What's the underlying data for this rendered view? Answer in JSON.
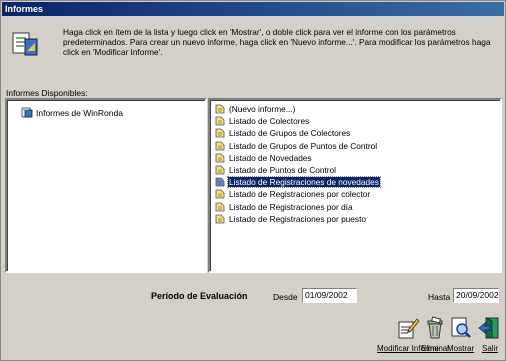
{
  "window": {
    "title": "Informes"
  },
  "info": {
    "icon": "report-info-icon",
    "text": "Haga click en ítem de la lista y luego click en 'Mostrar', o doble click para ver el informe con los parámetros predeterminados. Para crear un nuevo informe, haga click en 'Nuevo informe...'. Para modificar los parámetros haga click en 'Modificar Informe'."
  },
  "available_label": "Informes Disponibles:",
  "tree": {
    "items": [
      {
        "label": "Informes de WinRonda",
        "icon": "report-folder-icon"
      }
    ]
  },
  "reports": {
    "items": [
      {
        "label": "(Nuevo informe...)",
        "icon": "new-document-icon",
        "selected": false
      },
      {
        "label": "Listado de Colectores",
        "icon": "document-icon",
        "selected": false
      },
      {
        "label": "Listado de Grupos de Colectores",
        "icon": "document-icon",
        "selected": false
      },
      {
        "label": "Listado de Grupos de Puntos de Control",
        "icon": "document-icon",
        "selected": false
      },
      {
        "label": "Listado de Novedades",
        "icon": "document-icon",
        "selected": false
      },
      {
        "label": "Listado de Puntos de Control",
        "icon": "document-icon",
        "selected": false
      },
      {
        "label": "Listado de Registraciones de novedades",
        "icon": "document-icon",
        "selected": true
      },
      {
        "label": "Listado de Registraciones por colector",
        "icon": "document-icon",
        "selected": false
      },
      {
        "label": "Listado de Registraciones por día",
        "icon": "document-icon",
        "selected": false
      },
      {
        "label": "Listado de Registraciones por puesto",
        "icon": "document-icon",
        "selected": false
      }
    ]
  },
  "period": {
    "label": "Período de Evaluación",
    "from_label": "Desde",
    "from_value": "01/09/2002",
    "to_label": "Hasta",
    "to_value": "20/09/2002"
  },
  "toolbar": {
    "modify_label": "Modificar Informe",
    "delete_label": "Eliminar",
    "show_label": "Mostrar",
    "exit_label": "Salir"
  },
  "colors": {
    "title_bar": "#0a246a",
    "selection": "#0a246a",
    "window_bg": "#d4d0c8"
  }
}
